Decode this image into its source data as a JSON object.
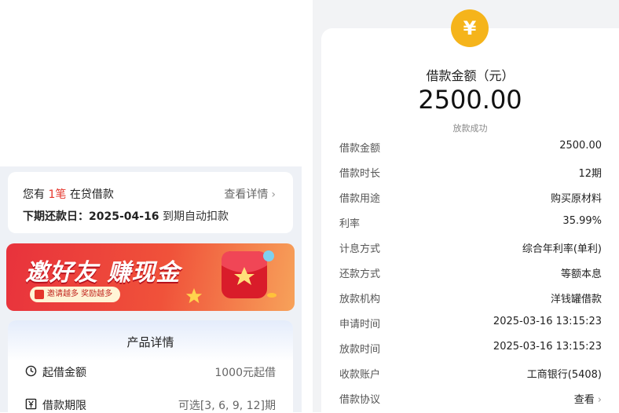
{
  "loan_card": {
    "prefix": "您有",
    "count": "1笔",
    "suffix": "在贷借款",
    "detail_link": "查看详情",
    "next_repay_label": "下期还款日：2025-04-16",
    "next_repay_note": "到期自动扣款"
  },
  "banner": {
    "title": "邀好友 赚现金",
    "pill": "邀请越多 奖励越多"
  },
  "product": {
    "title": "产品详情",
    "rows": [
      {
        "label": "起借金额",
        "value": "1000元起借",
        "icon": "clock-icon"
      },
      {
        "label": "借款期限",
        "value": "可选[3, 6, 9, 12]期",
        "icon": "yen-doc-icon"
      }
    ]
  },
  "receipt": {
    "badge": "¥",
    "amount_label": "借款金额（元）",
    "amount": "2500.00",
    "status": "放款成功",
    "rows": [
      {
        "key": "借款金额",
        "value": "2500.00"
      },
      {
        "key": "借款时长",
        "value": "12期"
      },
      {
        "key": "借款用途",
        "value": "购买原材料"
      },
      {
        "key": "利率",
        "value": "35.99%"
      },
      {
        "key": "计息方式",
        "value": "综合年利率(单利)"
      },
      {
        "key": "还款方式",
        "value": "等额本息"
      },
      {
        "key": "放款机构",
        "value": "洋钱罐借款"
      },
      {
        "key": "申请时间",
        "value": "2025-03-16 13:15:23"
      },
      {
        "key": "放款时间",
        "value": "2025-03-16 13:15:23"
      },
      {
        "key": "收款账户",
        "value": "工商银行(5408)"
      },
      {
        "key": "借款协议",
        "value": "查看"
      }
    ]
  },
  "colors": {
    "accent_red": "#e5352b",
    "badge_yellow": "#f5b41b"
  }
}
